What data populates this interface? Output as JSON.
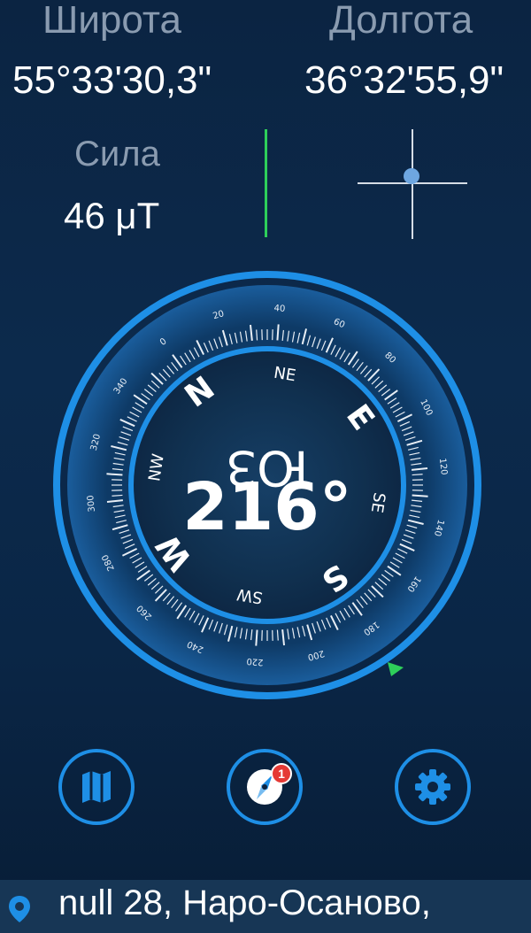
{
  "coordinates": {
    "latitude_label": "Широта",
    "latitude_value": "55°33'30,3\"",
    "longitude_label": "Долгота",
    "longitude_value": "36°32'55,9\""
  },
  "magnetic": {
    "label": "Сила",
    "value": "46 μT"
  },
  "compass": {
    "heading_deg": 216,
    "heading_text": "216°",
    "direction_text": "ЮЗ",
    "cardinals": [
      "N",
      "E",
      "S",
      "W"
    ],
    "intercardinals": [
      "NE",
      "SE",
      "SW",
      "NW"
    ],
    "degree_labels": [
      "0",
      "20",
      "40",
      "60",
      "80",
      "100",
      "120",
      "140",
      "160",
      "180",
      "200",
      "220",
      "240",
      "260",
      "280",
      "300",
      "320",
      "340"
    ]
  },
  "nav": {
    "map_icon": "map-icon",
    "compass_icon": "compass-icon",
    "settings_icon": "gear-icon",
    "badge_count": "1"
  },
  "address": {
    "text": "null 28, Наро-Осаново,"
  },
  "colors": {
    "background": "#0c2a4c",
    "accent": "#1e8fe6",
    "level_green": "#2ecf5a",
    "badge_red": "#e53935"
  }
}
